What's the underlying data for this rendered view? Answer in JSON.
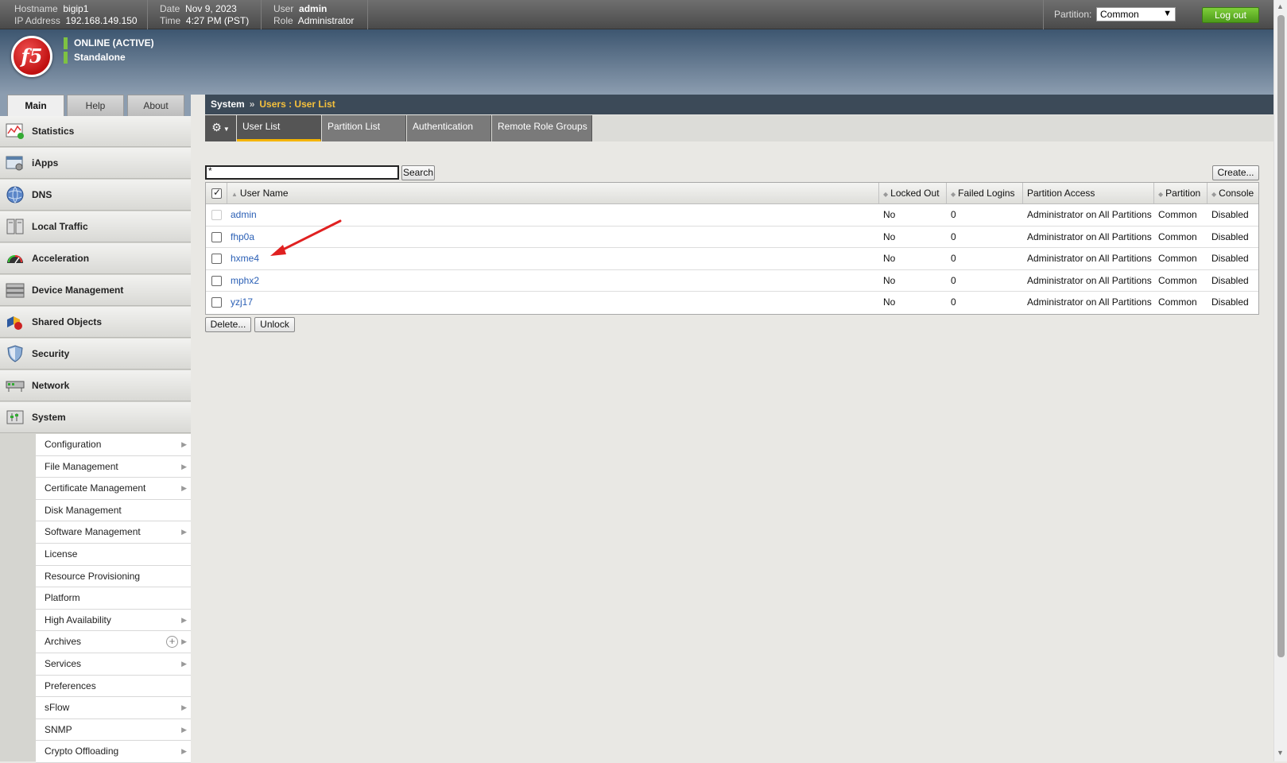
{
  "header": {
    "hostname_label": "Hostname",
    "hostname": "bigip1",
    "ip_label": "IP Address",
    "ip": "192.168.149.150",
    "date_label": "Date",
    "date": "Nov 9, 2023",
    "time_label": "Time",
    "time": "4:27 PM (PST)",
    "user_label": "User",
    "user": "admin",
    "role_label": "Role",
    "role": "Administrator",
    "partition_label": "Partition:",
    "partition_value": "Common",
    "logout_label": "Log out"
  },
  "banner": {
    "status": "ONLINE (ACTIVE)",
    "mode": "Standalone",
    "logo_text": "f5"
  },
  "left_tabs": [
    "Main",
    "Help",
    "About"
  ],
  "sidebar": {
    "items": [
      {
        "label": "Statistics",
        "icon": "statistics-icon"
      },
      {
        "label": "iApps",
        "icon": "iapps-icon"
      },
      {
        "label": "DNS",
        "icon": "dns-globe-icon"
      },
      {
        "label": "Local Traffic",
        "icon": "local-traffic-icon"
      },
      {
        "label": "Acceleration",
        "icon": "speedometer-icon"
      },
      {
        "label": "Device Management",
        "icon": "device-icon"
      },
      {
        "label": "Shared Objects",
        "icon": "shared-objects-icon"
      },
      {
        "label": "Security",
        "icon": "shield-icon"
      },
      {
        "label": "Network",
        "icon": "network-icon"
      },
      {
        "label": "System",
        "icon": "system-icon"
      }
    ],
    "system_submenu": [
      "Configuration",
      "File Management",
      "Certificate Management",
      "Disk Management",
      "Software Management",
      "License",
      "Resource Provisioning",
      "Platform",
      "High Availability",
      "Archives",
      "Services",
      "Preferences",
      "sFlow",
      "SNMP",
      "Crypto Offloading"
    ]
  },
  "breadcrumb": {
    "section": "System",
    "sep": "»",
    "current": "Users : User List"
  },
  "subtabs": [
    "User List",
    "Partition List",
    "Authentication",
    "Remote Role Groups"
  ],
  "search": {
    "value": "*",
    "button": "Search"
  },
  "create_button": "Create...",
  "table": {
    "headers": [
      "User Name",
      "Locked Out",
      "Failed Logins",
      "Partition Access",
      "Partition",
      "Console"
    ],
    "rows": [
      {
        "name": "admin",
        "locked": "No",
        "failed": "0",
        "access": "Administrator on All Partitions",
        "partition": "Common",
        "console": "Disabled"
      },
      {
        "name": "fhp0a",
        "locked": "No",
        "failed": "0",
        "access": "Administrator on All Partitions",
        "partition": "Common",
        "console": "Disabled"
      },
      {
        "name": "hxme4",
        "locked": "No",
        "failed": "0",
        "access": "Administrator on All Partitions",
        "partition": "Common",
        "console": "Disabled"
      },
      {
        "name": "mphx2",
        "locked": "No",
        "failed": "0",
        "access": "Administrator on All Partitions",
        "partition": "Common",
        "console": "Disabled"
      },
      {
        "name": "yzj17",
        "locked": "No",
        "failed": "0",
        "access": "Administrator on All Partitions",
        "partition": "Common",
        "console": "Disabled"
      }
    ]
  },
  "buttons": {
    "delete": "Delete...",
    "unlock": "Unlock"
  },
  "colors": {
    "accent": "#f4b400",
    "link": "#2a5fb5",
    "logout": "#5aa825",
    "status_bar": "#7ec242"
  }
}
